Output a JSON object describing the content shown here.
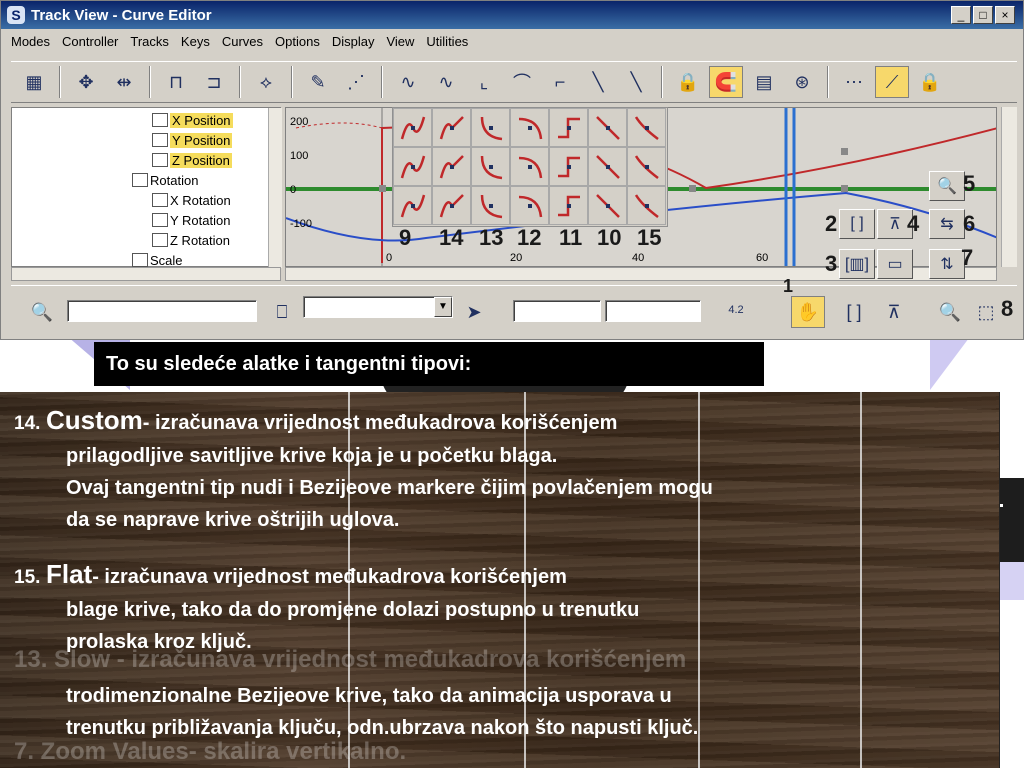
{
  "window": {
    "title": "Track View - Curve Editor",
    "title_icon": "S",
    "controls": [
      "_",
      "□",
      "×"
    ]
  },
  "menu": [
    "Modes",
    "Controller",
    "Tracks",
    "Keys",
    "Curves",
    "Options",
    "Display",
    "View",
    "Utilities"
  ],
  "tree": {
    "items": [
      {
        "label": "X Position",
        "selected": true
      },
      {
        "label": "Y Position",
        "selected": true
      },
      {
        "label": "Z Position",
        "selected": true
      },
      {
        "label": "Rotation",
        "selected": false
      },
      {
        "label": "X Rotation",
        "selected": false
      },
      {
        "label": "Y Rotation",
        "selected": false
      },
      {
        "label": "Z Rotation",
        "selected": false
      },
      {
        "label": "Scale",
        "selected": false
      }
    ]
  },
  "curve": {
    "y_ticks": [
      "200",
      "100",
      "0",
      "-100"
    ],
    "x_ticks": [
      "0",
      "20",
      "40",
      "60"
    ]
  },
  "callouts": {
    "row_numbers": [
      "9",
      "14",
      "13",
      "12",
      "11",
      "10",
      "15"
    ],
    "n1": "1",
    "n2": "2",
    "n3": "3",
    "n4": "4",
    "n5": "5",
    "n6": "6",
    "n7": "7",
    "n8": "8"
  },
  "status": {
    "frame_value": "4.2"
  },
  "banner": "To su sledeće alatke i tangentni tipovi:",
  "paragraphs": {
    "p14_num": "14.",
    "p14_term": "Custom",
    "p14_line1": "- izračunava vrijednost međukadrova korišćenjem",
    "p14_line2": "prilagodljive savitljive krive koja je u početku blaga.",
    "p14_line3": "Ovaj tangentni tip nudi i Bezijeove markere čijim povlačenjem mogu",
    "p14_line4": "da se naprave krive oštrijih uglova.",
    "p15_num": "15.",
    "p15_term": "Flat",
    "p15_line1": "- izračunava vrijednost međukadrova korišćenjem",
    "p15_line2": "blage krive, tako da do promjene dolazi postupno u trenutku",
    "p15_line3": "prolaska kroz ključ.",
    "slow_line2": "trodimenzionalne Bezijeove krive, tako da animacija usporava u",
    "slow_line3": "trenutku približavanja ključu, odn.ubrzava nakon što napusti ključ.",
    "ghost_slow": "13. Slow - izračunava vrijednost međukadrova korišćenjem",
    "ghost_zoom": "7. Zoom Values- skalira vertikalno."
  },
  "colors": {
    "title_bar": "#0a246a",
    "selection": "#f5dc5c",
    "curve_red": "#c0282a",
    "curve_blue": "#2a4ec8",
    "curve_green": "#2e8b2e",
    "banner_bg": "#000000"
  }
}
